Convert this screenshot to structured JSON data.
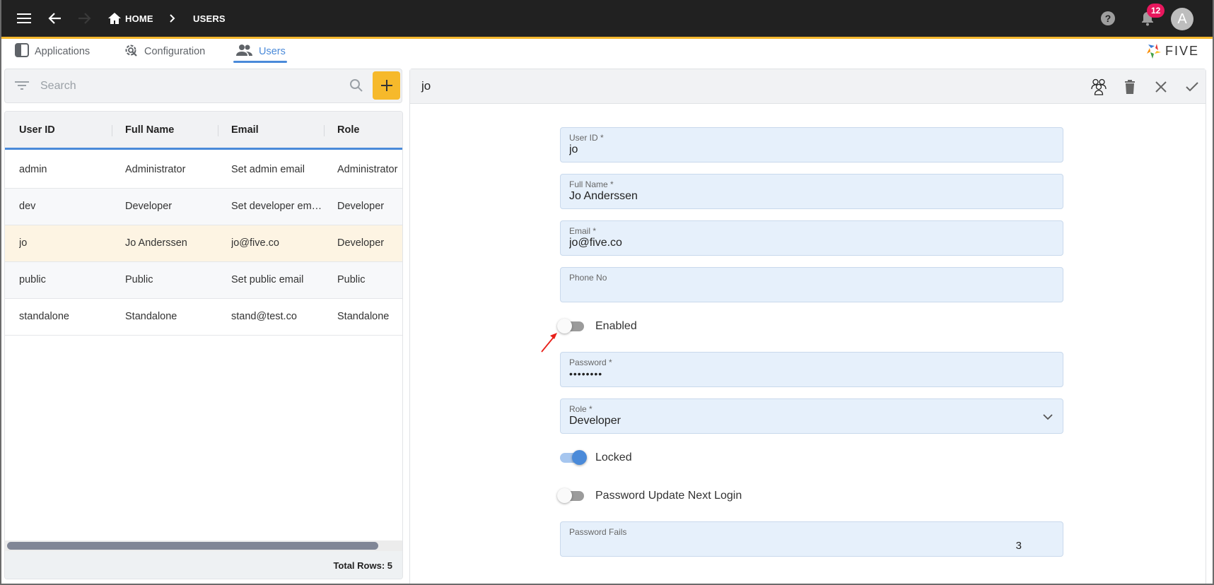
{
  "appbar": {
    "breadcrumb": [
      "HOME",
      "USERS"
    ],
    "notification_count": "12",
    "avatar_initial": "A",
    "icons": [
      "menu-icon",
      "back-arrow-icon",
      "forward-arrow-icon",
      "home-icon",
      "chevron-right-icon",
      "help-icon",
      "bell-icon"
    ]
  },
  "tabs": [
    {
      "label": "Applications",
      "icon": "applications-icon",
      "active": false
    },
    {
      "label": "Configuration",
      "icon": "configuration-gear-icon",
      "active": false
    },
    {
      "label": "Users",
      "icon": "users-icon",
      "active": true
    }
  ],
  "brand": {
    "logo_text": "FIVE"
  },
  "list": {
    "search_placeholder": "Search",
    "search_value": "",
    "add_label": "+",
    "columns": [
      "User ID",
      "Full Name",
      "Email",
      "Role"
    ],
    "rows": [
      {
        "user_id": "admin",
        "full_name": "Administrator",
        "email": "Set admin email",
        "role": "Administrator"
      },
      {
        "user_id": "dev",
        "full_name": "Developer",
        "email": "Set developer em…",
        "role": "Developer"
      },
      {
        "user_id": "jo",
        "full_name": "Jo Anderssen",
        "email": "jo@five.co",
        "role": "Developer"
      },
      {
        "user_id": "public",
        "full_name": "Public",
        "email": "Set public email",
        "role": "Public"
      },
      {
        "user_id": "standalone",
        "full_name": "Standalone",
        "email": "stand@test.co",
        "role": "Standalone"
      }
    ],
    "selected_row": 2,
    "total_rows_label": "Total Rows: 5"
  },
  "detail": {
    "title": "jo",
    "actions": [
      "user-roles-icon",
      "delete-icon",
      "close-icon",
      "save-check-icon"
    ],
    "fields": {
      "user_id": {
        "label": "User ID *",
        "value": "jo"
      },
      "full_name": {
        "label": "Full Name *",
        "value": "Jo Anderssen"
      },
      "email": {
        "label": "Email *",
        "value": "jo@five.co"
      },
      "phone": {
        "label": "Phone No",
        "value": ""
      },
      "password": {
        "label": "Password *",
        "value": "••••••••"
      },
      "role": {
        "label": "Role *",
        "value": "Developer"
      },
      "password_fails": {
        "label": "Password Fails",
        "value": "3"
      }
    },
    "toggles": {
      "enabled": {
        "label": "Enabled",
        "on": false
      },
      "locked": {
        "label": "Locked",
        "on": true
      },
      "password_update": {
        "label": "Password Update Next Login",
        "on": false
      }
    }
  },
  "colors": {
    "appbar": "#212121",
    "accent_yellow": "#f5b82e",
    "primary_blue": "#4a8ad9",
    "badge": "#e8175d",
    "field_bg": "#e6f0fb",
    "selected_row": "#fdf4e3",
    "annotation_arrow": "#e8201a"
  }
}
